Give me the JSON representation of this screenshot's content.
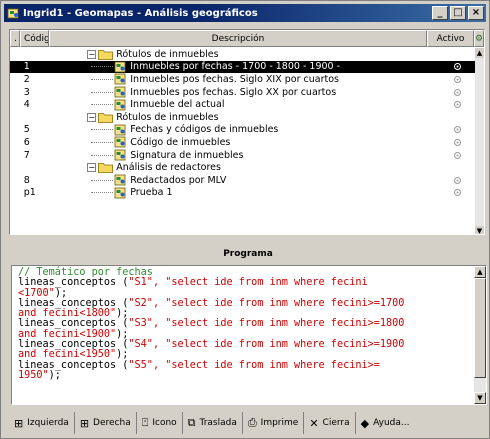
{
  "window": {
    "title": "Ingrid1 - Geomapas - Análisis geográficos",
    "minimize": "_",
    "maximize": "□",
    "close": "×"
  },
  "grid": {
    "headers": {
      "dot": ".",
      "codigo": "Código",
      "descripcion": "Descripción",
      "activo": "Activo"
    },
    "rows": [
      {
        "code": "",
        "label": "Rótulos de inmuebles",
        "type": "folder",
        "level": 0
      },
      {
        "code": "1",
        "label": "Inmuebles por fechas - 1700 - 1800 - 1900 -",
        "type": "doc",
        "level": 1,
        "selected": true
      },
      {
        "code": "2",
        "label": "Inmuebles pos fechas. Siglo XIX por cuartos",
        "type": "doc",
        "level": 1
      },
      {
        "code": "3",
        "label": "Inmuebles pos fechas. Siglo XX por cuartos",
        "type": "doc",
        "level": 1
      },
      {
        "code": "4",
        "label": "Inmueble del actual",
        "type": "doc",
        "level": 1
      },
      {
        "code": "",
        "label": "Rótulos de inmuebles",
        "type": "folder",
        "level": 0
      },
      {
        "code": "5",
        "label": "Fechas y códigos de inmuebles",
        "type": "doc",
        "level": 1
      },
      {
        "code": "6",
        "label": "Código de inmuebles",
        "type": "doc",
        "level": 1
      },
      {
        "code": "7",
        "label": "Signatura de inmuebles",
        "type": "doc",
        "level": 1
      },
      {
        "code": "",
        "label": "Análisis de redactores",
        "type": "folder",
        "level": 0
      },
      {
        "code": "8",
        "label": "Redactados por MLV",
        "type": "doc",
        "level": 1
      },
      {
        "code": "p1",
        "label": "Prueba 1",
        "type": "doc",
        "level": 1
      }
    ]
  },
  "programa": {
    "title": "Programa",
    "lines": [
      [
        {
          "t": "// Temático por fechas",
          "c": "comment"
        }
      ],
      [
        {
          "t": "lineas_conceptos (",
          "c": "black"
        },
        {
          "t": "\"S1\", \"select ide from inm where fecini",
          "c": "str"
        }
      ],
      [
        {
          "t": "<1700\"",
          "c": "str"
        },
        {
          "t": ");",
          "c": "black"
        }
      ],
      [
        {
          "t": "lineas_conceptos (",
          "c": "black"
        },
        {
          "t": "\"S2\", \"select ide from inm where fecini>=1700",
          "c": "str"
        }
      ],
      [
        {
          "t": "and fecini<1800\"",
          "c": "str"
        },
        {
          "t": ");",
          "c": "black"
        }
      ],
      [
        {
          "t": "lineas_conceptos (",
          "c": "black"
        },
        {
          "t": "\"S3\", \"select ide from inm where fecini>=1800",
          "c": "str"
        }
      ],
      [
        {
          "t": "and fecini<1900\"",
          "c": "str"
        },
        {
          "t": ");",
          "c": "black"
        }
      ],
      [
        {
          "t": "lineas_conceptos (",
          "c": "black"
        },
        {
          "t": "\"S4\", \"select ide from inm where fecini>=1900",
          "c": "str"
        }
      ],
      [
        {
          "t": "and fecini<1950\"",
          "c": "str"
        },
        {
          "t": ");",
          "c": "black"
        }
      ],
      [
        {
          "t": "lineas_conceptos (",
          "c": "black"
        },
        {
          "t": "\"S5\", \"select ide from inm where fecini>=",
          "c": "str"
        }
      ],
      [
        {
          "t": "1950\"",
          "c": "str"
        },
        {
          "t": ");",
          "c": "black"
        }
      ]
    ]
  },
  "toolbar": {
    "buttons": [
      {
        "name": "izquierda-button",
        "label": "Izquierda",
        "icon": "⊞"
      },
      {
        "name": "derecha-button",
        "label": "Derecha",
        "icon": "⊞"
      },
      {
        "name": "icono-button",
        "label": "Icono",
        "icon": "⍞"
      },
      {
        "name": "traslada-button",
        "label": "Traslada",
        "icon": "⧉"
      },
      {
        "name": "imprime-button",
        "label": "Imprime",
        "icon": "⎙"
      },
      {
        "name": "cierra-button",
        "label": "Cierra",
        "icon": "✕"
      },
      {
        "name": "ayuda-button",
        "label": "Ayuda...",
        "icon": "◆"
      }
    ]
  },
  "colors": {
    "titlebar": "#0a246a",
    "selection": "#000000",
    "comment": "#2f8a2f",
    "string": "#cc0000"
  }
}
